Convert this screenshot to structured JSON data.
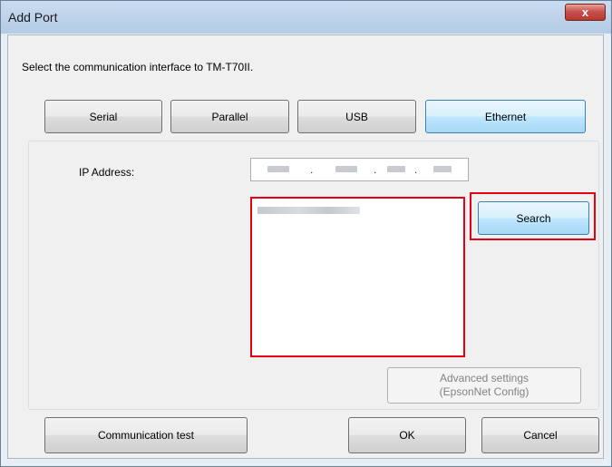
{
  "window": {
    "title": "Add Port",
    "close_glyph": "x"
  },
  "instruction": "Select the communication interface to TM-T70II.",
  "interfaces": {
    "serial": "Serial",
    "parallel": "Parallel",
    "usb": "USB",
    "ethernet": "Ethernet",
    "selected": "Ethernet"
  },
  "ip": {
    "label": "IP Address:",
    "separator": "."
  },
  "search_button": "Search",
  "advanced": {
    "line1": "Advanced settings",
    "line2": "(EpsonNet Config)"
  },
  "footer": {
    "test_button": "Communication test",
    "ok_button": "OK",
    "cancel_button": "Cancel"
  },
  "colors": {
    "highlight": "#e60012",
    "selected_tab": "#bee6fd"
  }
}
